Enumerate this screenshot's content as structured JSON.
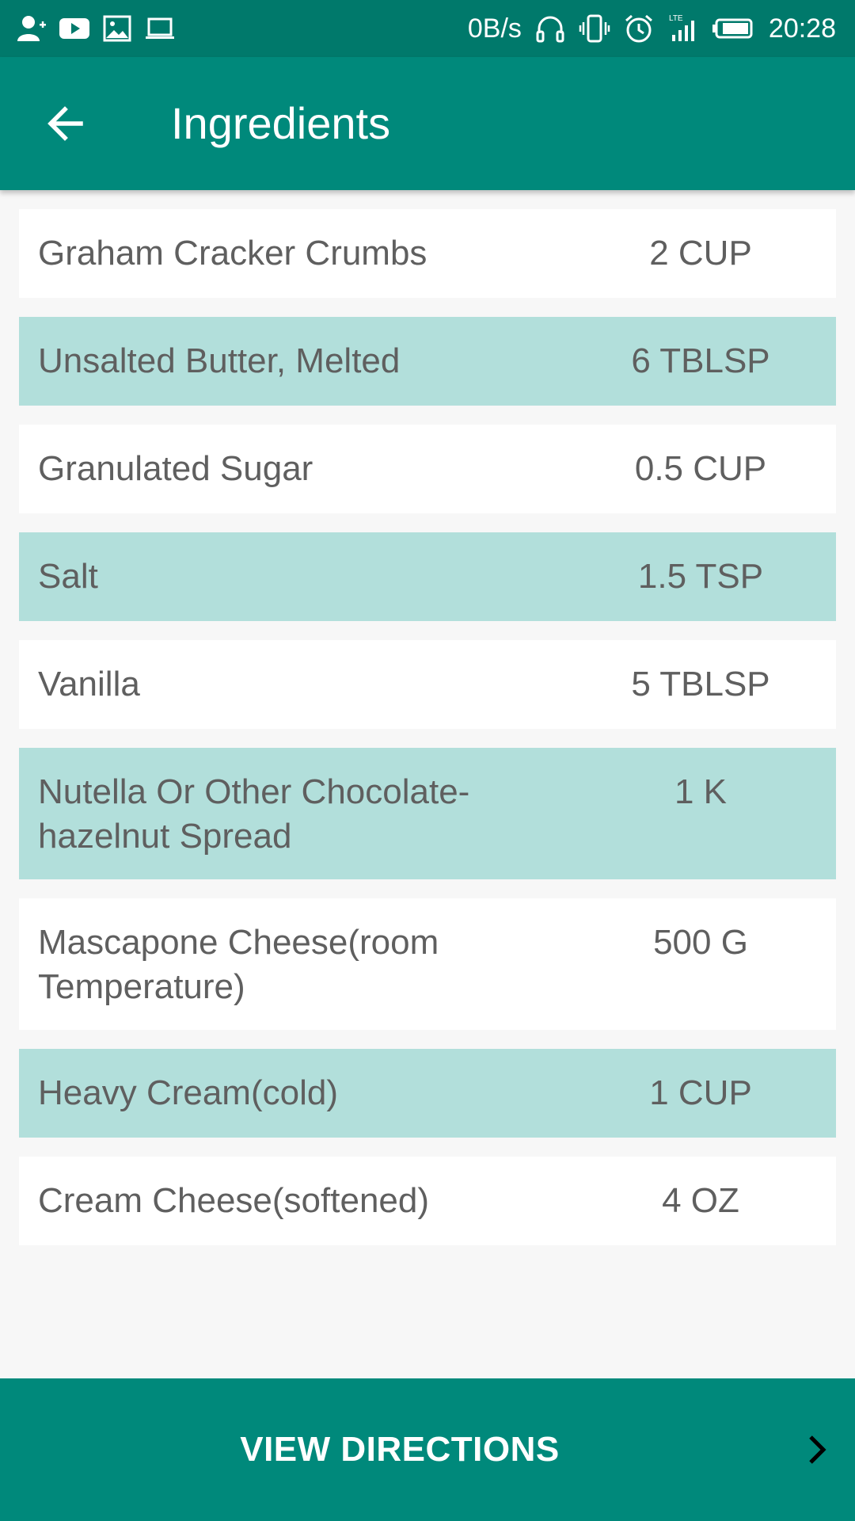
{
  "status_bar": {
    "left_icons": [
      "add-user-icon",
      "youtube-icon",
      "image-icon",
      "laptop-icon"
    ],
    "network_speed": "0B/s",
    "network_type": "LTE",
    "time": "20:28"
  },
  "app_bar": {
    "title": "Ingredients",
    "back_icon": "arrow-left-icon"
  },
  "ingredients": [
    {
      "name": "Graham Cracker Crumbs",
      "quantity": "2 CUP"
    },
    {
      "name": "Unsalted Butter, Melted",
      "quantity": "6 TBLSP"
    },
    {
      "name": "Granulated Sugar",
      "quantity": "0.5 CUP"
    },
    {
      "name": "Salt",
      "quantity": "1.5 TSP"
    },
    {
      "name": "Vanilla",
      "quantity": "5 TBLSP"
    },
    {
      "name": "Nutella Or Other Chocolate-hazelnut Spread",
      "quantity": "1 K"
    },
    {
      "name": "Mascapone Cheese(room Temperature)",
      "quantity": "500 G"
    },
    {
      "name": "Heavy Cream(cold)",
      "quantity": "1 CUP"
    },
    {
      "name": "Cream Cheese(softened)",
      "quantity": "4 OZ"
    }
  ],
  "bottom_bar": {
    "label": "VIEW DIRECTIONS",
    "chevron_icon": "chevron-right-icon"
  },
  "colors": {
    "status_bar": "#00796b",
    "primary": "#00897b",
    "row_alt": "#b2dfdb",
    "row": "#ffffff",
    "text": "#5f5f5f"
  }
}
